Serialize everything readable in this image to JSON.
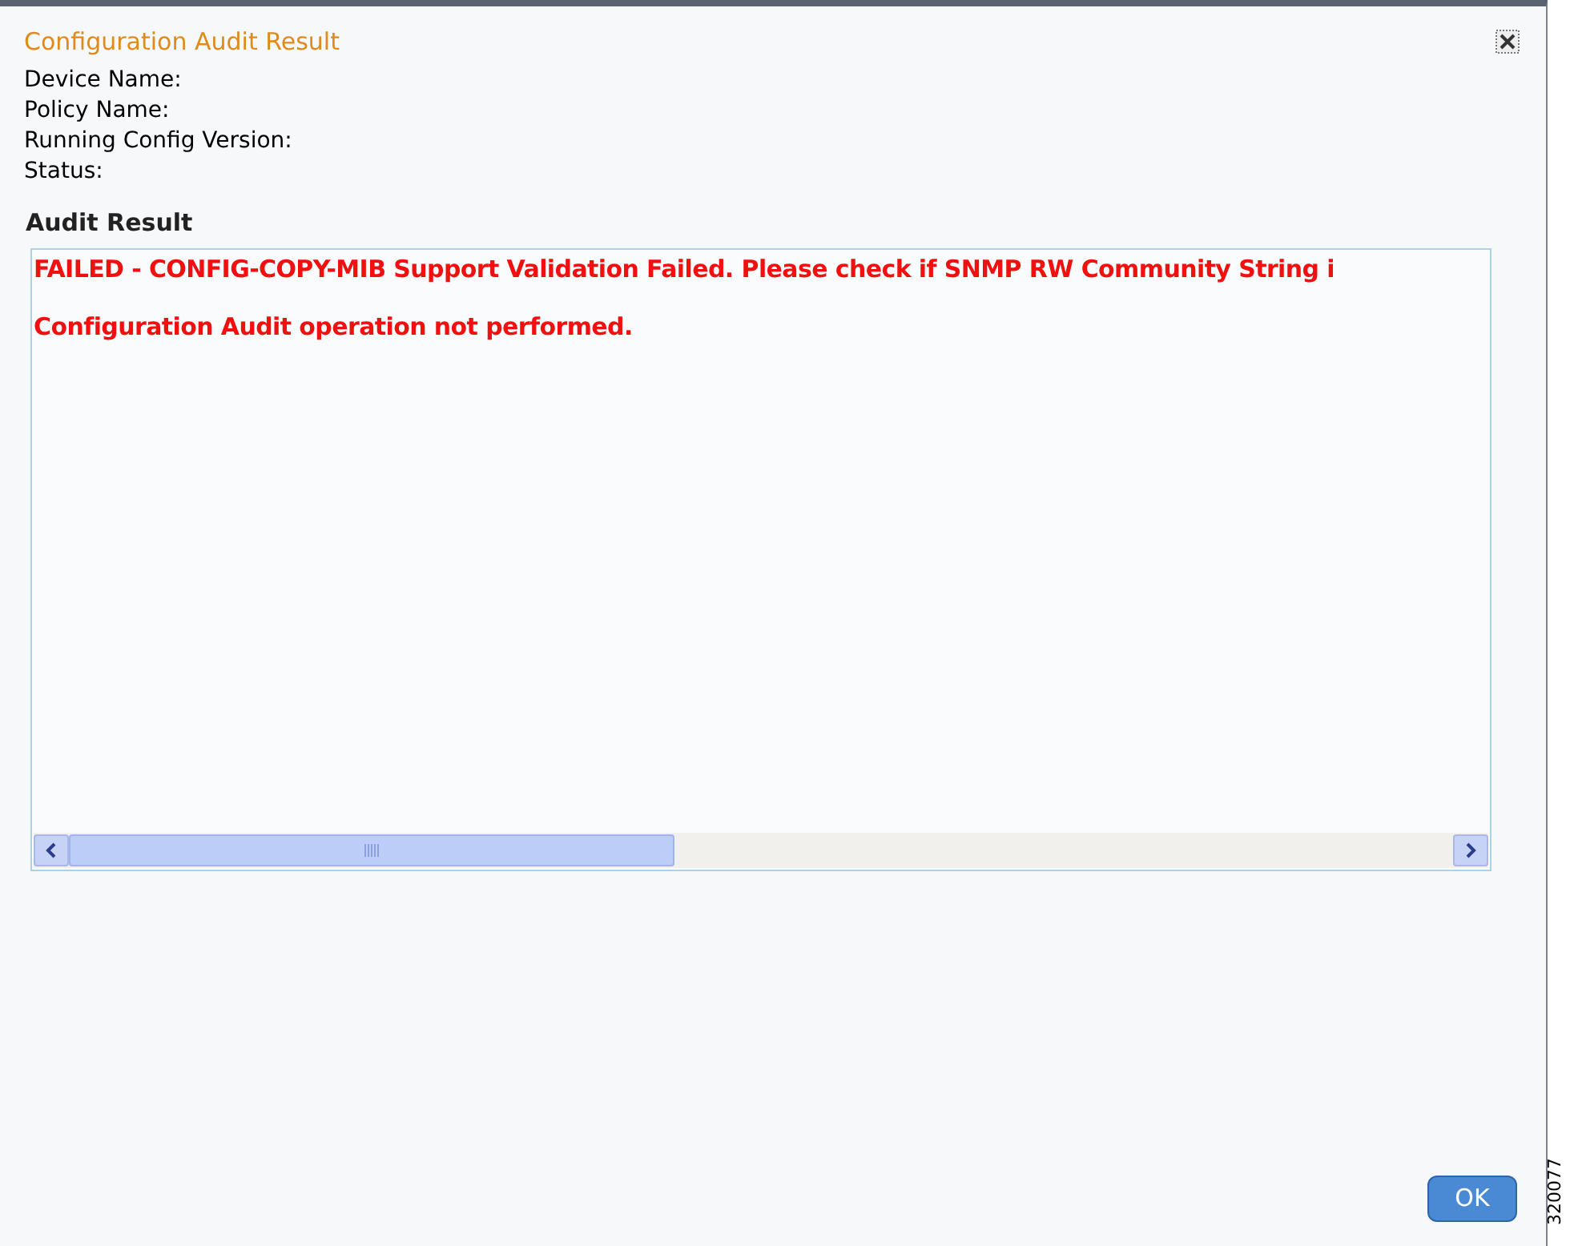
{
  "dialog": {
    "title": "Configuration Audit Result"
  },
  "fields": [
    {
      "label": "Device Name:"
    },
    {
      "label": "Policy Name:"
    },
    {
      "label": "Running Config Version:"
    },
    {
      "label": "Status:"
    }
  ],
  "section_title": "Audit Result",
  "result_lines": [
    "FAILED - CONFIG-COPY-MIB Support Validation Failed. Please check if SNMP RW Community String i",
    "Configuration Audit operation not performed."
  ],
  "buttons": [
    {
      "label": "OK"
    }
  ],
  "figure_id": "320077"
}
